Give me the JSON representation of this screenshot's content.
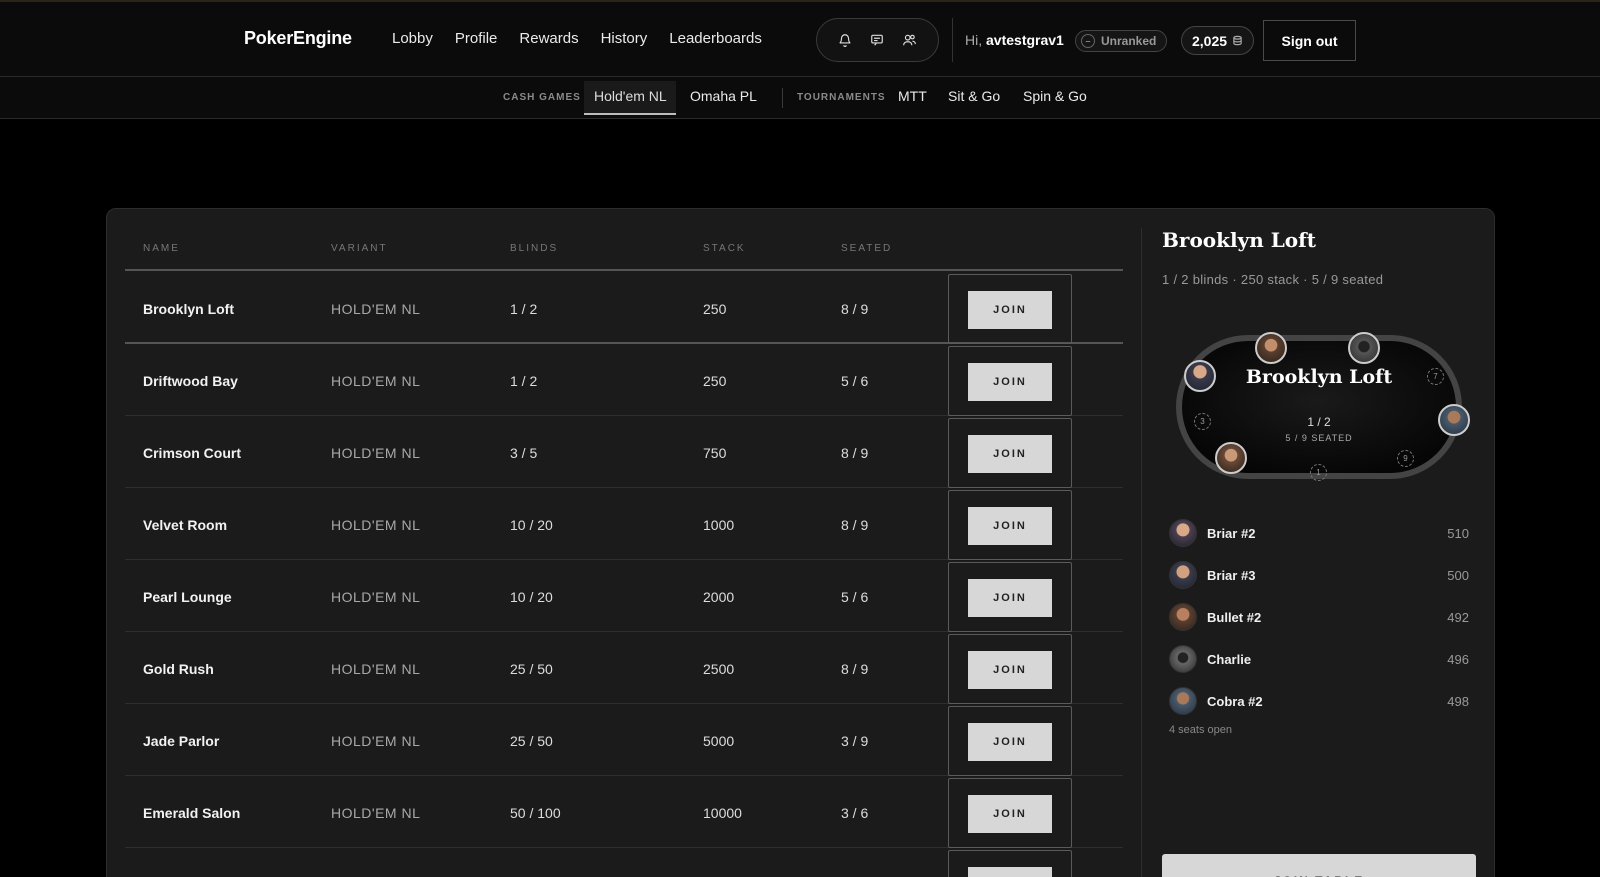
{
  "brand": "PokerEngine",
  "nav": [
    "Lobby",
    "Profile",
    "Rewards",
    "History",
    "Leaderboards"
  ],
  "user": {
    "greeting": "Hi,",
    "username": "avtestgrav1",
    "rank": "Unranked",
    "chips": "2,025",
    "signout_label": "Sign out"
  },
  "icons": [
    "bell-icon",
    "chat-icon",
    "friends-icon",
    "chip-icon"
  ],
  "subnav": {
    "cash_label": "CASH GAMES",
    "cash_tabs": [
      "Hold'em NL",
      "Omaha PL"
    ],
    "tournament_label": "TOURNAMENTS",
    "tournament_tabs": [
      "MTT",
      "Sit & Go",
      "Spin & Go"
    ],
    "active_tab": "Hold'em NL"
  },
  "table_headers": [
    "NAME",
    "VARIANT",
    "BLINDS",
    "STACK",
    "SEATED"
  ],
  "join_label": "JOIN",
  "rows": [
    {
      "name": "Brooklyn Loft",
      "variant": "HOLD'EM NL",
      "blinds": "1 / 2",
      "stack": "250",
      "seated": "8 / 9"
    },
    {
      "name": "Driftwood Bay",
      "variant": "HOLD'EM NL",
      "blinds": "1 / 2",
      "stack": "250",
      "seated": "5 / 6"
    },
    {
      "name": "Crimson Court",
      "variant": "HOLD'EM NL",
      "blinds": "3 / 5",
      "stack": "750",
      "seated": "8 / 9"
    },
    {
      "name": "Velvet Room",
      "variant": "HOLD'EM NL",
      "blinds": "10 / 20",
      "stack": "1000",
      "seated": "8 / 9"
    },
    {
      "name": "Pearl Lounge",
      "variant": "HOLD'EM NL",
      "blinds": "10 / 20",
      "stack": "2000",
      "seated": "5 / 6"
    },
    {
      "name": "Gold Rush",
      "variant": "HOLD'EM NL",
      "blinds": "25 / 50",
      "stack": "2500",
      "seated": "8 / 9"
    },
    {
      "name": "Jade Parlor",
      "variant": "HOLD'EM NL",
      "blinds": "25 / 50",
      "stack": "5000",
      "seated": "3 / 9"
    },
    {
      "name": "Emerald Salon",
      "variant": "HOLD'EM NL",
      "blinds": "50 / 100",
      "stack": "10000",
      "seated": "3 / 6"
    }
  ],
  "detail": {
    "title": "Brooklyn Loft",
    "subtitle": "1 / 2 blinds · 250 stack · 5 / 9 seated",
    "table_name": "Brooklyn Loft",
    "table_blinds": "1 / 2",
    "table_seated": "5 / 9 SEATED",
    "empty_seats": [
      "3",
      "7",
      "9",
      "1"
    ],
    "players": [
      {
        "name": "Briar #2",
        "stack": "510"
      },
      {
        "name": "Briar #3",
        "stack": "500"
      },
      {
        "name": "Bullet #2",
        "stack": "492"
      },
      {
        "name": "Charlie",
        "stack": "496"
      },
      {
        "name": "Cobra #2",
        "stack": "498"
      }
    ],
    "seats_open": "4 seats open",
    "join_table_label": "JOIN TABLE"
  }
}
